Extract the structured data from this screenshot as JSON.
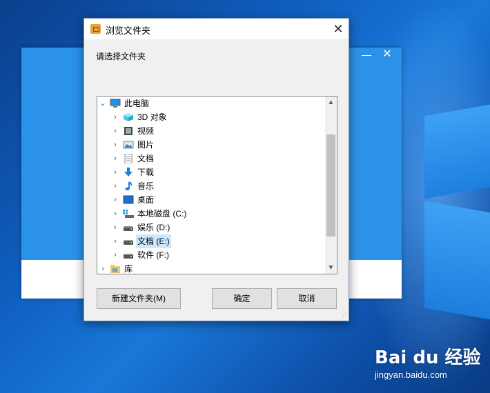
{
  "background_window": {
    "minimize_glyph": "—",
    "close_glyph": "✕"
  },
  "dialog": {
    "title": "浏览文件夹",
    "close_glyph": "✕",
    "prompt": "请选择文件夹",
    "tree": [
      {
        "label": "此电脑",
        "icon": "computer-icon",
        "expanded": true
      },
      {
        "label": "3D 对象",
        "icon": "cube-3d-icon"
      },
      {
        "label": "视频",
        "icon": "video-icon"
      },
      {
        "label": "图片",
        "icon": "picture-icon"
      },
      {
        "label": "文档",
        "icon": "document-icon"
      },
      {
        "label": "下载",
        "icon": "download-arrow-icon"
      },
      {
        "label": "音乐",
        "icon": "music-note-icon"
      },
      {
        "label": "桌面",
        "icon": "desktop-icon"
      },
      {
        "label": "本地磁盘 (C:)",
        "icon": "system-drive-icon"
      },
      {
        "label": "娱乐 (D:)",
        "icon": "drive-icon"
      },
      {
        "label": "文档 (E:)",
        "icon": "drive-icon",
        "selected": true
      },
      {
        "label": "软件 (F:)",
        "icon": "drive-icon"
      },
      {
        "label": "库",
        "icon": "library-folder-icon"
      }
    ],
    "buttons": {
      "new_folder": "新建文件夹(M)",
      "ok": "确定",
      "cancel": "取消"
    }
  },
  "watermark": {
    "logo": "Bai du 经验",
    "url": "jingyan.baidu.com"
  },
  "colors": {
    "accent_blue": "#2b92ea",
    "selection": "#cce8ff"
  }
}
